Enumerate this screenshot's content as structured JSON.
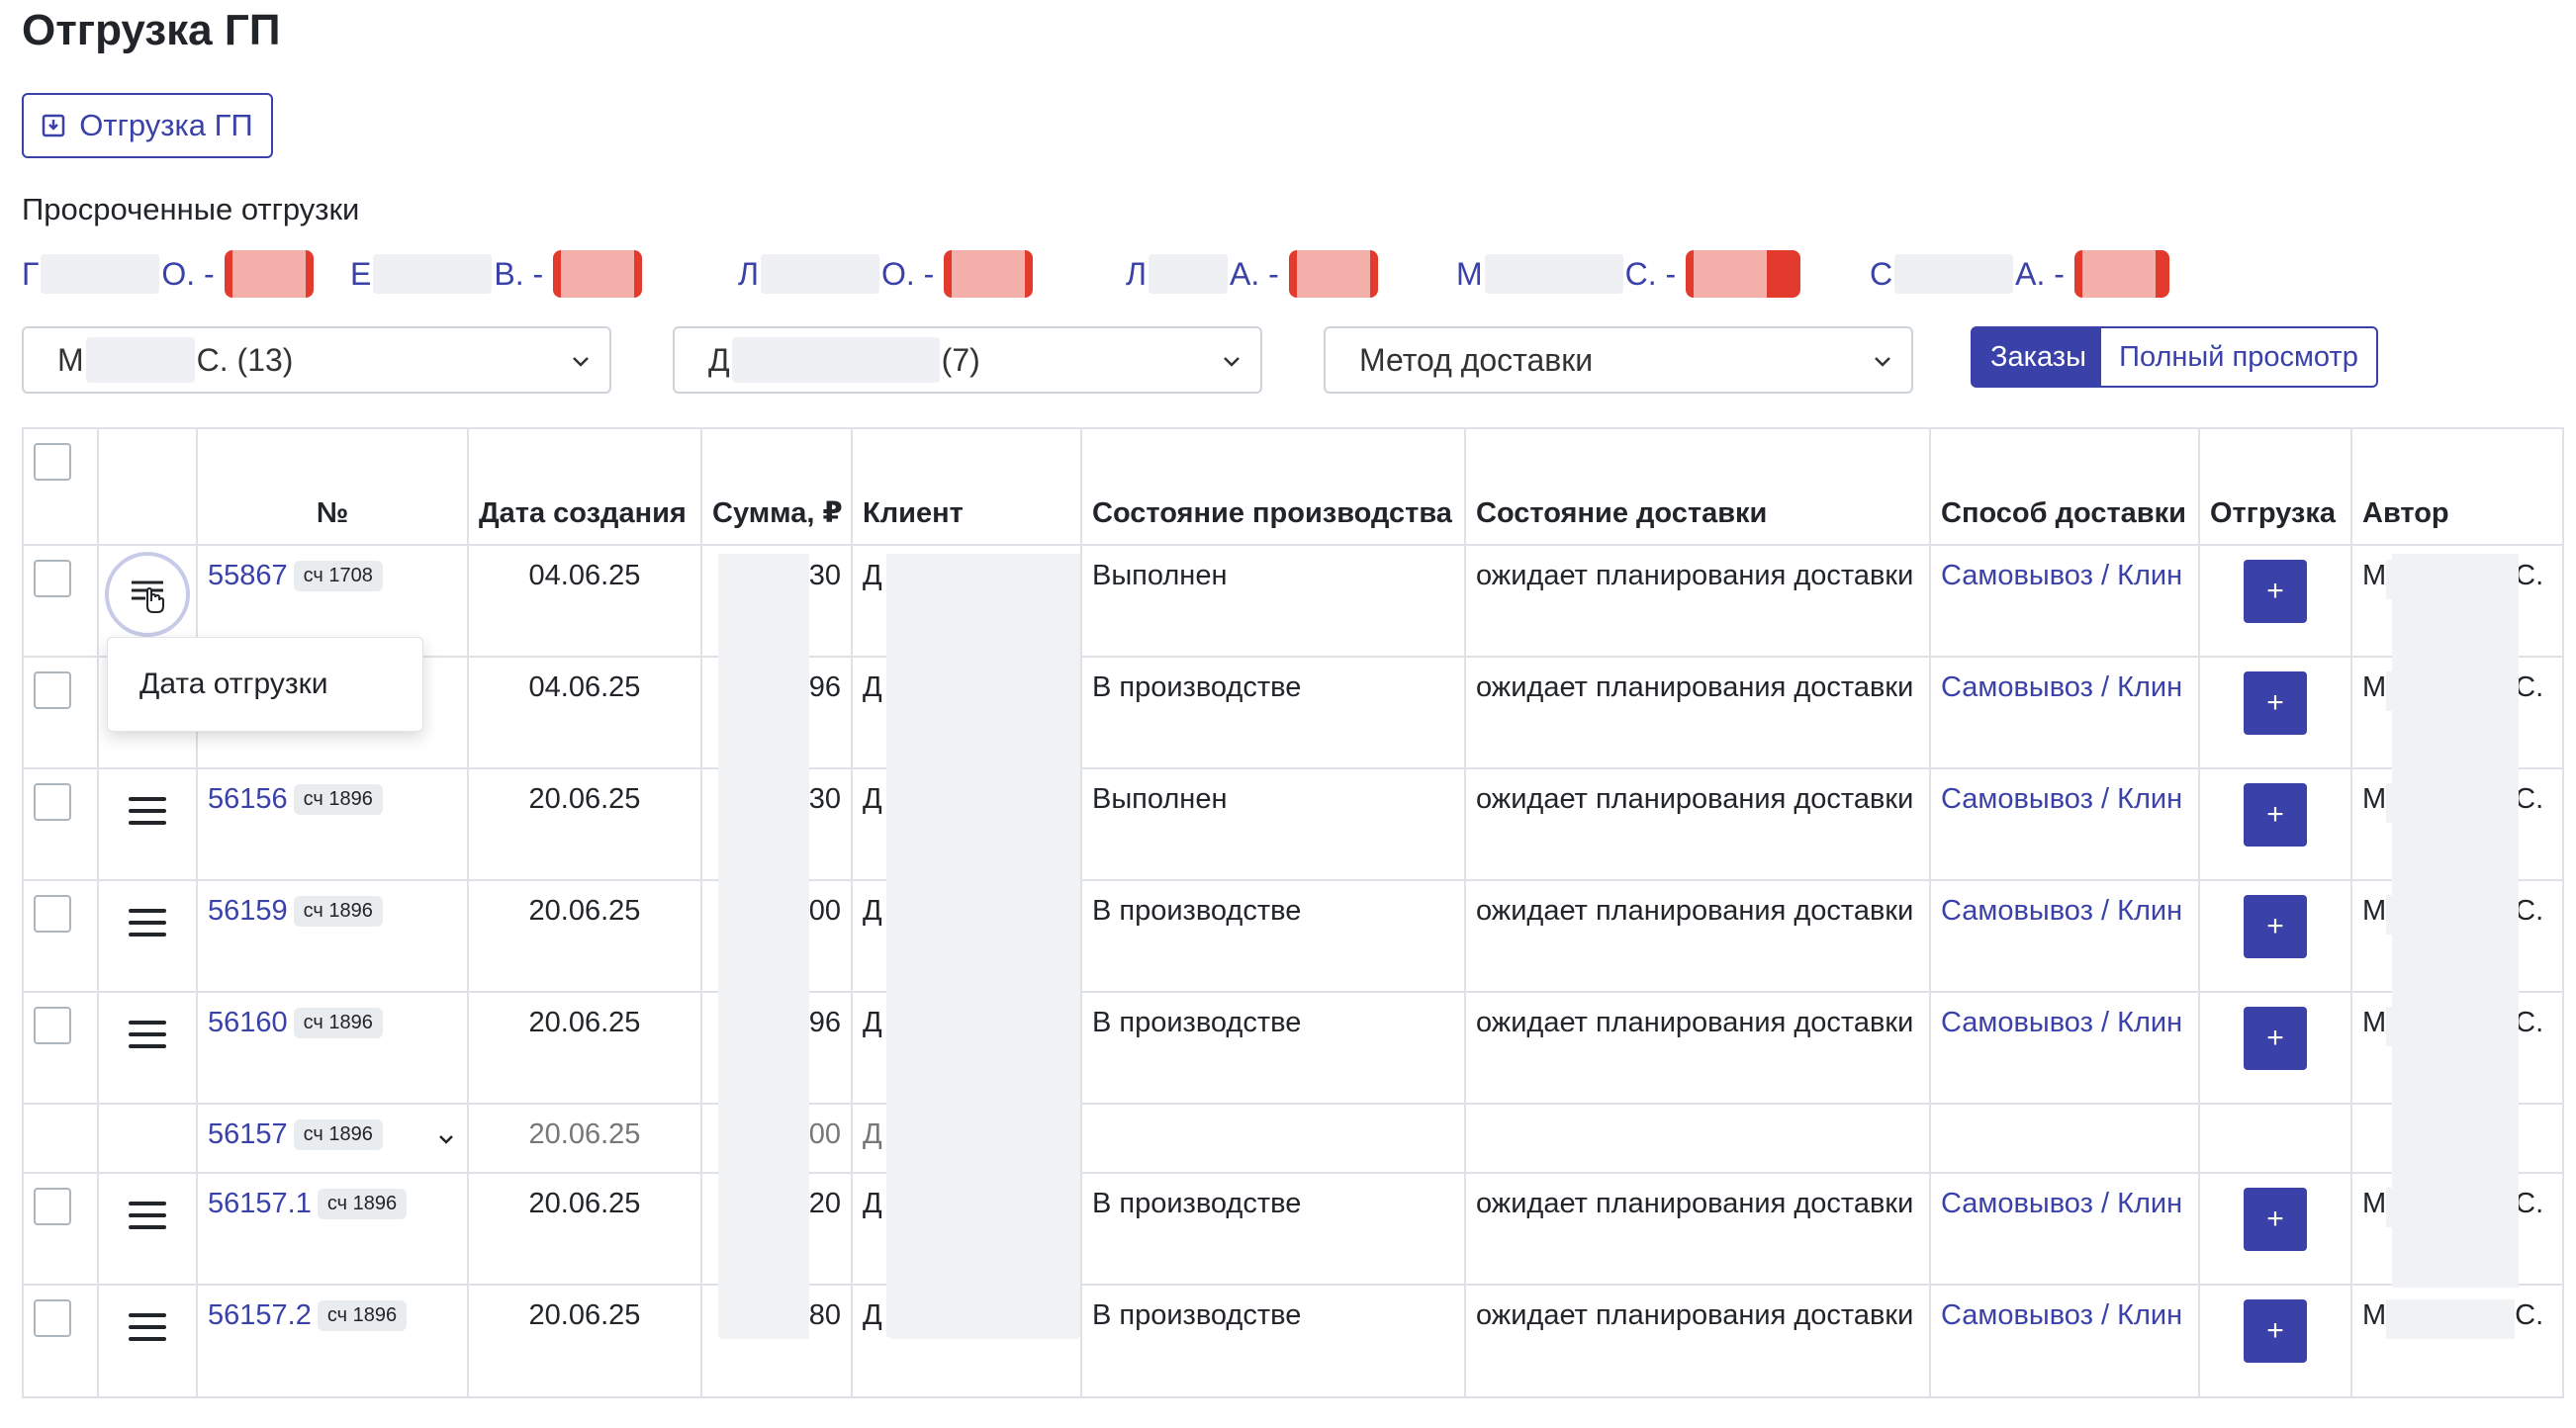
{
  "page": {
    "title": "Отгрузка ГП"
  },
  "toolbar": {
    "export_label": "Отгрузка ГП"
  },
  "overdue": {
    "title": "Просроченные отгрузки",
    "items": [
      {
        "prefix": "Г",
        "suffix": "О. -"
      },
      {
        "prefix": "Е",
        "suffix": "В. -"
      },
      {
        "prefix": "Л",
        "suffix": "О. -"
      },
      {
        "prefix": "Л",
        "suffix": "А. -"
      },
      {
        "prefix": "М",
        "suffix": "С. -"
      },
      {
        "prefix": "С",
        "suffix": "А. -"
      }
    ]
  },
  "filters": {
    "manager": {
      "prefix": "М",
      "suffix": "С. (13)"
    },
    "client": {
      "prefix": "Д",
      "suffix": "(7)"
    },
    "delivery_method": {
      "placeholder": "Метод доставки"
    }
  },
  "view_toggle": {
    "orders": "Заказы",
    "full": "Полный просмотр"
  },
  "table": {
    "headers": {
      "number": "№",
      "created": "Дата создания",
      "amount": "Сумма, ₽",
      "client": "Клиент",
      "production": "Состояние производства",
      "delivery_state": "Состояние доставки",
      "delivery_method": "Способ доставки",
      "shipment": "Отгрузка",
      "author": "Автор"
    },
    "rows": [
      {
        "number": "55867",
        "invoice": "сч 1708",
        "date": "04.06.25",
        "amount_tail": "30",
        "client_prefix": "Д",
        "production": "Выполнен",
        "delivery_state": "ожидает планирования доставки",
        "delivery_method": "Самовывоз / Клин",
        "author_prefix": "М",
        "author_suffix": "С."
      },
      {
        "number": "",
        "invoice": "",
        "date": "04.06.25",
        "amount_tail": "96",
        "client_prefix": "Д",
        "production": "В производстве",
        "delivery_state": "ожидает планирования доставки",
        "delivery_method": "Самовывоз / Клин",
        "author_prefix": "М",
        "author_suffix": "С."
      },
      {
        "number": "56156",
        "invoice": "сч 1896",
        "date": "20.06.25",
        "amount_tail": "30",
        "client_prefix": "Д",
        "production": "Выполнен",
        "delivery_state": "ожидает планирования доставки",
        "delivery_method": "Самовывоз / Клин",
        "author_prefix": "М",
        "author_suffix": "С."
      },
      {
        "number": "56159",
        "invoice": "сч 1896",
        "date": "20.06.25",
        "amount_tail": "00",
        "client_prefix": "Д",
        "production": "В производстве",
        "delivery_state": "ожидает планирования доставки",
        "delivery_method": "Самовывоз / Клин",
        "author_prefix": "М",
        "author_suffix": "С."
      },
      {
        "number": "56160",
        "invoice": "сч 1896",
        "date": "20.06.25",
        "amount_tail": "96",
        "client_prefix": "Д",
        "production": "В производстве",
        "delivery_state": "ожидает планирования доставки",
        "delivery_method": "Самовывоз / Клин",
        "author_prefix": "М",
        "author_suffix": "С."
      }
    ],
    "group_row": {
      "number": "56157",
      "invoice": "сч 1896",
      "date": "20.06.25",
      "amount_tail": "00",
      "client_prefix": "Д"
    },
    "sub_rows": [
      {
        "number": "56157.1",
        "invoice": "сч 1896",
        "date": "20.06.25",
        "amount_tail": "20",
        "client_prefix": "Д",
        "production": "В производстве",
        "delivery_state": "ожидает планирования доставки",
        "delivery_method": "Самовывоз / Клин",
        "author_prefix": "М",
        "author_suffix": "С."
      },
      {
        "number": "56157.2",
        "invoice": "сч 1896",
        "date": "20.06.25",
        "amount_tail": "80",
        "client_prefix": "Д",
        "production": "В производстве",
        "delivery_state": "ожидает планирования доставки",
        "delivery_method": "Самовывоз / Клин",
        "author_prefix": "М",
        "author_suffix": "С."
      }
    ],
    "add_label": "+"
  },
  "row_menu": {
    "item": "Дата отгрузки"
  },
  "colors": {
    "primary": "#3a41a8",
    "border": "#dee2e6",
    "badge": "#e9ecef",
    "overdue_badge": "#e23b2e"
  }
}
